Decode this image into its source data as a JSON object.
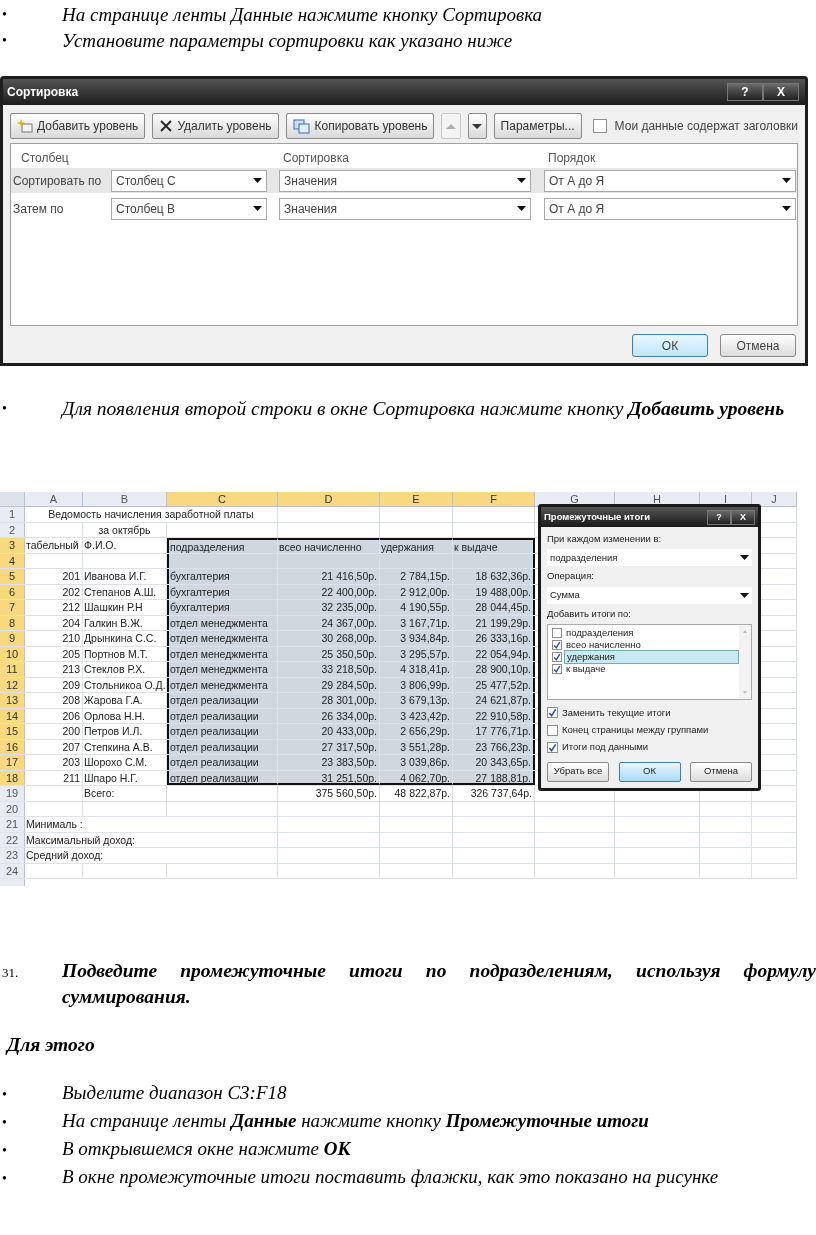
{
  "instructions_top": [
    {
      "marker": "•",
      "text": "На странице ленты Данные нажмите кнопку  Сортировка"
    },
    {
      "marker": "•",
      "text": "Установите параметры сортировки как указано ниже"
    }
  ],
  "sort_dialog": {
    "title": "Сортировка",
    "title_buttons": [
      "?",
      "X"
    ],
    "toolbar_buttons": [
      "Добавить уровень",
      "Удалить уровень",
      "Копировать уровень"
    ],
    "move_up": {
      "disabled": true
    },
    "move_down": {
      "disabled": false
    },
    "options_button": "Параметры...",
    "headers_checkbox": {
      "label": "Мои данные содержат заголовки",
      "checked": false
    },
    "headers": [
      "Столбец",
      "Сортировка",
      "Порядок"
    ],
    "rows": [
      {
        "label": "Сортировать по",
        "column": "Столбец C",
        "sort_on": "Значения",
        "order": "От А до Я",
        "selected": true
      },
      {
        "label": "Затем по",
        "column": "Столбец B",
        "sort_on": "Значения",
        "order": "От А до Я",
        "selected": false
      }
    ],
    "buttons": [
      {
        "label": "ОК",
        "default": true
      },
      {
        "label": "Отмена",
        "default": false
      }
    ]
  },
  "middle_note": {
    "marker": "•",
    "text": "Для появления второй строки в окне Сортировка нажмите кнопку **Добавить уровень**"
  },
  "spreadsheet": {
    "columns": [
      {
        "label": "A",
        "selected": false
      },
      {
        "label": "B",
        "selected": false
      },
      {
        "label": "C",
        "selected": true
      },
      {
        "label": "D",
        "selected": true
      },
      {
        "label": "E",
        "selected": true
      },
      {
        "label": "F",
        "selected": true
      },
      {
        "label": "G",
        "selected": false
      },
      {
        "label": "H",
        "selected": false
      },
      {
        "label": "I",
        "selected": false
      },
      {
        "label": "J",
        "selected": false
      }
    ],
    "rows": [
      {
        "number": "1",
        "selected": false,
        "kind": "title",
        "cells": {
          "A": "Ведомость начисления заработной платы"
        }
      },
      {
        "number": "2",
        "selected": false,
        "kind": "subtitle",
        "cells": {
          "B": "за октябрь"
        }
      },
      {
        "number": "3",
        "selected": true,
        "kind": "header",
        "cells": {
          "A": "табельный",
          "B": "Ф.И.О.",
          "C": "подразделения",
          "D": "всео начисленно",
          "E": "удержания",
          "F": "к выдаче"
        }
      },
      {
        "number": "4",
        "selected": true,
        "kind": "data"
      },
      {
        "number": "5",
        "selected": true,
        "kind": "data",
        "cells": {
          "A": "201",
          "B": "Иванова И.Г.",
          "C": "бухгалтерия",
          "D": "21 416,50р.",
          "E": "2 784,15р.",
          "F": "18 632,36р."
        }
      },
      {
        "number": "6",
        "selected": true,
        "kind": "data",
        "cells": {
          "A": "202",
          "B": "Степанов А.Ш.",
          "C": "бухгалтерия",
          "D": "22 400,00р.",
          "E": "2 912,00р.",
          "F": "19 488,00р."
        }
      },
      {
        "number": "7",
        "selected": true,
        "kind": "data",
        "cells": {
          "A": "212",
          "B": "Шашкин Р.Н",
          "C": "бухгалтерия",
          "D": "32 235,00р.",
          "E": "4 190,55р.",
          "F": "28 044,45р."
        }
      },
      {
        "number": "8",
        "selected": true,
        "kind": "data",
        "cells": {
          "A": "204",
          "B": "Галкин В.Ж.",
          "C": "отдел менеджмента",
          "D": "24 367,00р.",
          "E": "3 167,71р.",
          "F": "21 199,29р."
        }
      },
      {
        "number": "9",
        "selected": true,
        "kind": "data",
        "cells": {
          "A": "210",
          "B": "Дрынкина С.С.",
          "C": "отдел менеджмента",
          "D": "30 268,00р.",
          "E": "3 934,84р.",
          "F": "26 333,16р."
        }
      },
      {
        "number": "10",
        "selected": true,
        "kind": "data",
        "cells": {
          "A": "205",
          "B": "Портнов М.Т.",
          "C": "отдел менеджмента",
          "D": "25 350,50р.",
          "E": "3 295,57р.",
          "F": "22 054,94р."
        }
      },
      {
        "number": "11",
        "selected": true,
        "kind": "data",
        "cells": {
          "A": "213",
          "B": "Стеклов Р.Х.",
          "C": "отдел менеджмента",
          "D": "33 218,50р.",
          "E": "4 318,41р.",
          "F": "28 900,10р."
        }
      },
      {
        "number": "12",
        "selected": true,
        "kind": "data",
        "cells": {
          "A": "209",
          "B": "Стольникоа О.Д.",
          "C": "отдел менеджмента",
          "D": "29 284,50р.",
          "E": "3 806,99р.",
          "F": "25 477,52р."
        }
      },
      {
        "number": "13",
        "selected": true,
        "kind": "data",
        "cells": {
          "A": "208",
          "B": "Жарова Г.А.",
          "C": "отдел реализации",
          "D": "28 301,00р.",
          "E": "3 679,13р.",
          "F": "24 621,87р."
        }
      },
      {
        "number": "14",
        "selected": true,
        "kind": "data",
        "cells": {
          "A": "206",
          "B": "Орлова Н.Н.",
          "C": "отдел реализации",
          "D": "26 334,00р.",
          "E": "3 423,42р.",
          "F": "22 910,58р."
        }
      },
      {
        "number": "15",
        "selected": true,
        "kind": "data",
        "cells": {
          "A": "200",
          "B": "Петров И.Л.",
          "C": "отдел реализации",
          "D": "20 433,00р.",
          "E": "2 656,29р.",
          "F": "17 776,71р."
        }
      },
      {
        "number": "16",
        "selected": true,
        "kind": "data",
        "cells": {
          "A": "207",
          "B": "Степкина А.В.",
          "C": "отдел реализации",
          "D": "27 317,50р.",
          "E": "3 551,28р.",
          "F": "23 766,23р."
        }
      },
      {
        "number": "17",
        "selected": true,
        "kind": "data",
        "cells": {
          "A": "203",
          "B": "Шорохо С.М.",
          "C": "отдел реализации",
          "D": "23 383,50р.",
          "E": "3 039,86р.",
          "F": "20 343,65р."
        }
      },
      {
        "number": "18",
        "selected": true,
        "kind": "data",
        "cells": {
          "A": "211",
          "B": "Шпаро Н.Г.",
          "C": "отдел реализации",
          "D": "31 251,50р.",
          "E": "4 062,70р.",
          "F": "27 188,81р."
        }
      },
      {
        "number": "19",
        "selected": false,
        "kind": "data",
        "cells": {
          "B": "Всего:",
          "D": "375 560,50р.",
          "E": "48 822,87р.",
          "F": "326 737,64р."
        }
      },
      {
        "number": "20",
        "selected": false,
        "kind": "data"
      },
      {
        "number": "21",
        "selected": false,
        "kind": "summary",
        "cells": {
          "A": "Минималь :"
        }
      },
      {
        "number": "22",
        "selected": false,
        "kind": "summary",
        "cells": {
          "A": "Максимальный доход:"
        }
      },
      {
        "number": "23",
        "selected": false,
        "kind": "summary",
        "cells": {
          "A": "Средний доход:"
        }
      },
      {
        "number": "24",
        "selected": false,
        "kind": "data"
      }
    ],
    "subtotal_dialog": {
      "title": "Промежуточные итоги",
      "title_buttons": [
        "?",
        "X"
      ],
      "group_label": "При каждом изменении в:",
      "group_value": "подразделения",
      "operation_label": "Операция:",
      "operation_value": "Сумма",
      "add_label": "Добавить итоги по:",
      "add_items": [
        {
          "label": "подразделения",
          "checked": false,
          "selected": false
        },
        {
          "label": "всео начисленно",
          "checked": true,
          "selected": false
        },
        {
          "label": "удержания",
          "checked": true,
          "selected": true
        },
        {
          "label": "к выдаче",
          "checked": true,
          "selected": false
        }
      ],
      "options": [
        {
          "label": "Заменить текущие итоги",
          "checked": true
        },
        {
          "label": "Конец страницы между группами",
          "checked": false
        },
        {
          "label": "Итоги под данными",
          "checked": true
        }
      ],
      "buttons": [
        {
          "label": "Убрать все",
          "default": false
        },
        {
          "label": "ОК",
          "default": true
        },
        {
          "label": "Отмена",
          "default": false
        }
      ]
    }
  },
  "step": {
    "number": "31.",
    "text": "Подведите промежуточные итоги по подразделениям, используя формулу суммирования."
  },
  "subheading": "Для этого",
  "steps": [
    {
      "marker": "•",
      "text": "Выделите диапазон C3:F18"
    },
    {
      "marker": "•",
      "text": "На странице ленты **Данные** нажмите кнопку **Промежуточные итоги**"
    },
    {
      "marker": "•",
      "text": "В открывшемся окне нажмите **ОК**"
    },
    {
      "marker": "•",
      "text": "В окне промежуточные итоги поставить флажки, как это показано на рисунке"
    }
  ]
}
